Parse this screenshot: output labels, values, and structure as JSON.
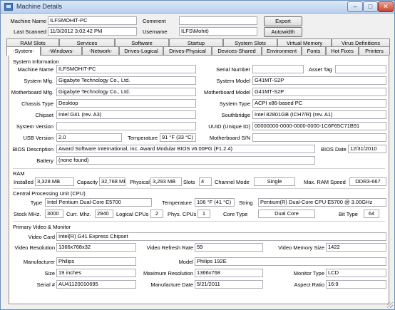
{
  "window": {
    "title": "Machine Details",
    "minimize_glyph": "–",
    "maximize_glyph": "□",
    "close_glyph": "✕"
  },
  "header": {
    "machine_name_label": "Machine Name",
    "machine_name": "ILFSMOHIT-PC",
    "last_scanned_label": "Last Scanned",
    "last_scanned": "11/3/2012 3:02:42 PM",
    "comment_label": "Comment",
    "comment": "",
    "username_label": "Username",
    "username": "ILFS\\Mohit)",
    "export_label": "Export",
    "autowidth_label": "Autowidth"
  },
  "tabs_top": [
    "RAM Slots",
    "Services",
    "Software",
    "Startup",
    "System Slots",
    "Virtual Memory",
    "Virus Definitions"
  ],
  "tabs_bottom": [
    "-System-",
    "-Windows-",
    "-Network-",
    "Drives-Logical",
    "Drives-Physical",
    "Devices-Shared",
    "Environment",
    "Fonts",
    "Hot Fixes",
    "Printers"
  ],
  "active_tab": "-System-",
  "system": {
    "heading": "System Information",
    "machine_name_label": "Machine Name",
    "machine_name": "ILFSMOHIT-PC",
    "serial_number_label": "Serial Number",
    "serial_number": "",
    "asset_tag_label": "Asset Tag",
    "asset_tag": "",
    "system_mfg_label": "System Mfg.",
    "system_mfg": "Gigabyte Technology Co., Ltd.",
    "system_model_label": "System Model",
    "system_model": "G41MT-S2P",
    "mb_mfg_label": "Motherboard Mfg.",
    "mb_mfg": "Gigabyte Technology Co., Ltd.",
    "mb_model_label": "Motherboard Model",
    "mb_model": "G41MT-S2P",
    "chassis_label": "Chassis Type",
    "chassis": "Desktop",
    "system_type_label": "System Type",
    "system_type": "ACPI x86-based PC",
    "chipset_label": "Chipset",
    "chipset": "Intel G41 (rev. A3)",
    "southbridge_label": "Southbridge",
    "southbridge": "Intel 82801GB (ICH7/R) (rev. A1)",
    "sys_version_label": "System Version",
    "sys_version": "",
    "uuid_label": "UUID (Unique ID)",
    "uuid": "00000000-0000-0000-0000-1C6F65C71B91",
    "usb_label": "USB Version",
    "usb": "2.0",
    "temp_label": "Temperature",
    "temp": "91 °F (33 °C)",
    "mb_sn_label": "Motherboard S/N",
    "mb_sn": "",
    "bios_desc_label": "BIOS Description",
    "bios_desc": "Award Software International, Inc. Award Modular BIOS v6.00PG (F1.2.4)",
    "bios_date_label": "BIOS Date",
    "bios_date": "12/31/2010",
    "battery_label": "Battery",
    "battery": "(none found)"
  },
  "ram": {
    "heading": "RAM",
    "installed_label": "Installed",
    "installed": "3,328 MB",
    "capacity_label": "Capacity",
    "capacity": "32,768 MB",
    "physical_label": "Physical",
    "physical": "3,293 MB",
    "slots_label": "Slots",
    "slots": "4",
    "channel_label": "Channel Mode",
    "channel": "Single",
    "max_speed_label": "Max. RAM Speed",
    "max_speed": "DDR3-667"
  },
  "cpu": {
    "heading": "Central Processing Unit (CPU)",
    "type_label": "Type",
    "type": "Intel Pentium Dual-Core E5700",
    "temp_label": "Temperature",
    "temp": "106 °F (41 °C)",
    "string_label": "String",
    "string": "Pentium(R) Dual-Core CPU E5700 @ 3.00GHz",
    "stock_label": "Stock MHz.",
    "stock": "3000",
    "curr_label": "Curr. Mhz.",
    "curr": "2940",
    "logical_label": "Logical CPUs",
    "logical": "2",
    "phys_label": "Phys. CPUs",
    "phys": "1",
    "core_label": "Core Type",
    "core": "Dual Core",
    "bit_label": "Bit Type",
    "bit": "64"
  },
  "video": {
    "heading": "Primary Video & Monitor",
    "card_label": "Video Card",
    "card": "Intel(R) G41 Express Chipset",
    "res_label": "Video Resolution",
    "res": "1366x768x32",
    "refresh_label": "Video Refresh Rate",
    "refresh": "59",
    "mem_label": "Video Memory Size",
    "mem": "1422",
    "mfr_label": "Manufacturer",
    "mfr": "Philips",
    "model_label": "Model",
    "model": "Philips 192E",
    "size_label": "Size",
    "size": "19 inches",
    "maxres_label": "Maximum Resolution",
    "maxres": "1366x768",
    "montype_label": "Monitor Type",
    "montype": "LCD",
    "serial_label": "Serial #",
    "serial": "AU41120010695",
    "mfgdate_label": "Manufacture Date",
    "mfgdate": "5/21/2011",
    "aspect_label": "Aspect Ratio",
    "aspect": "16:9"
  }
}
